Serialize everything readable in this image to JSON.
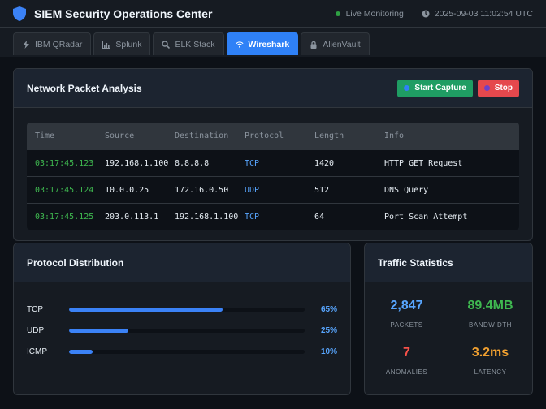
{
  "header": {
    "title": "SIEM Security Operations Center",
    "live_status": "Live Monitoring",
    "timestamp": "2025-09-03 11:02:54 UTC"
  },
  "tabs": [
    {
      "label": "IBM QRadar",
      "icon": "bolt-icon",
      "active": false
    },
    {
      "label": "Splunk",
      "icon": "chart-icon",
      "active": false
    },
    {
      "label": "ELK Stack",
      "icon": "search-icon",
      "active": false
    },
    {
      "label": "Wireshark",
      "icon": "wifi-icon",
      "active": true
    },
    {
      "label": "AlienVault",
      "icon": "lock-icon",
      "active": false
    }
  ],
  "packet_panel": {
    "title": "Network Packet Analysis",
    "start_label": "Start Capture",
    "stop_label": "Stop",
    "columns": [
      "Time",
      "Source",
      "Destination",
      "Protocol",
      "Length",
      "Info"
    ],
    "rows": [
      [
        "03:17:45.123",
        "192.168.1.100",
        "8.8.8.8",
        "TCP",
        "1420",
        "HTTP GET Request"
      ],
      [
        "03:17:45.124",
        "10.0.0.25",
        "172.16.0.50",
        "UDP",
        "512",
        "DNS Query"
      ],
      [
        "03:17:45.125",
        "203.0.113.1",
        "192.168.1.100",
        "TCP",
        "64",
        "Port Scan Attempt"
      ]
    ]
  },
  "distribution": {
    "title": "Protocol Distribution",
    "items": [
      {
        "label": "TCP",
        "pct_text": "65%",
        "value": 0.65
      },
      {
        "label": "UDP",
        "pct_text": "25%",
        "value": 0.25
      },
      {
        "label": "ICMP",
        "pct_text": "10%",
        "value": 0.1
      }
    ]
  },
  "traffic": {
    "title": "Traffic Statistics",
    "stats": [
      {
        "value": "2,847",
        "label": "PACKETS",
        "color": "#58a6ff"
      },
      {
        "value": "89.4MB",
        "label": "BANDWIDTH",
        "color": "#3fb950"
      },
      {
        "value": "7",
        "label": "ANOMALIES",
        "color": "#f85149"
      },
      {
        "value": "3.2ms",
        "label": "LATENCY",
        "color": "#f0a030"
      }
    ]
  },
  "colors": {
    "accent": "#2f81f7",
    "success": "#1f9d63",
    "danger": "#e5484d",
    "background": "#0d1117",
    "panel": "#161b22"
  }
}
